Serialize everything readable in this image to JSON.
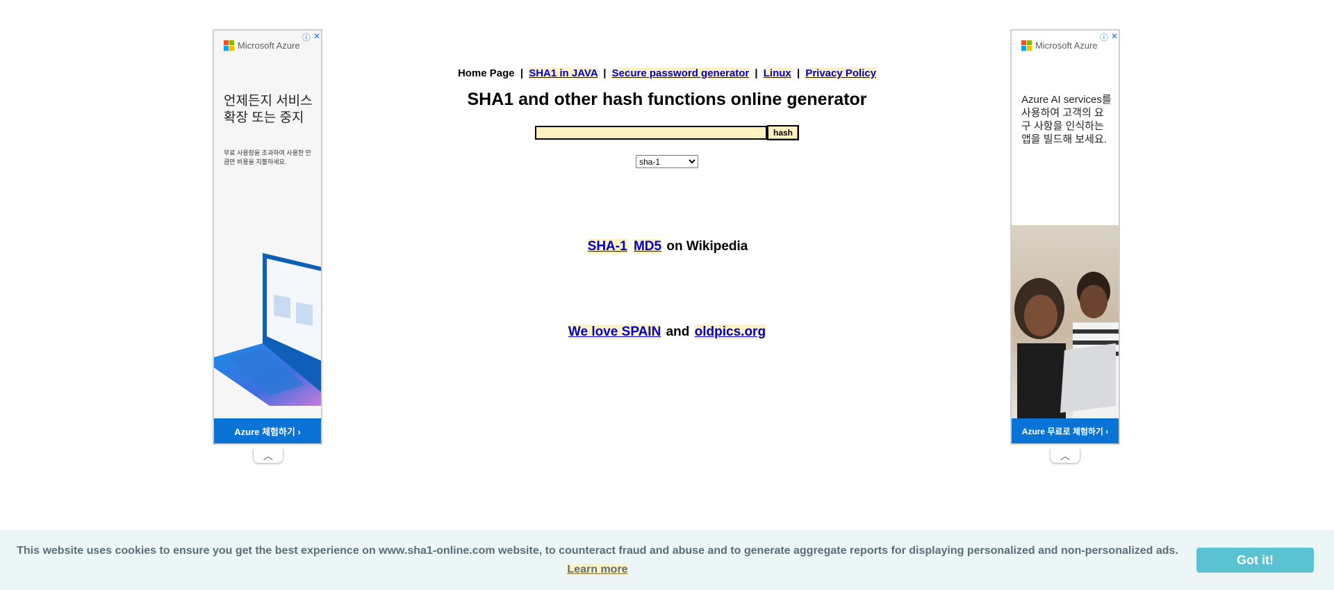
{
  "nav": {
    "home": "Home Page",
    "sep": "|",
    "links": [
      "SHA1 in JAVA",
      "Secure password generator",
      "Linux",
      "Privacy Policy"
    ]
  },
  "main": {
    "title": "SHA1 and other hash functions online generator",
    "hash_input_value": "",
    "hash_button": "hash",
    "algorithm_selected": "sha-1"
  },
  "wiki": {
    "link1": "SHA-1",
    "link2": "MD5",
    "suffix": "on Wikipedia"
  },
  "promo": {
    "link1": "We love SPAIN",
    "middle": "and",
    "link2": "oldpics.org"
  },
  "ad_left": {
    "brand": "Microsoft Azure",
    "headline": "언제든지 서비스 확장 또는 중지",
    "sub": "무료 사용량을 초과하여 사용한 만큼만 비용을 지불하세요.",
    "cta": "Azure 체험하기 ›",
    "info_icon": "ⓘ",
    "close_icon": "✕"
  },
  "ad_right": {
    "brand": "Microsoft Azure",
    "headline": "Azure AI services를 사용하여 고객의 요구 사항을 인식하는 앱을 빌드해 보세요.",
    "cta": "Azure 무료로 체험하기 ›",
    "info_icon": "ⓘ",
    "close_icon": "✕"
  },
  "cookie": {
    "text": "This website uses cookies to ensure you get the best experience on www.sha1-online.com website, to counteract fraud and abuse and to generate aggregate reports for displaying personalized and non-personalized ads.",
    "learn_more": "Learn more",
    "button": "Got it!"
  },
  "colors": {
    "link": "#0000cc",
    "highlight": "#fff1c2",
    "azure_blue": "#0a74d6",
    "cookie_bg": "#edf6f6",
    "cookie_button": "#5bc2d1"
  }
}
